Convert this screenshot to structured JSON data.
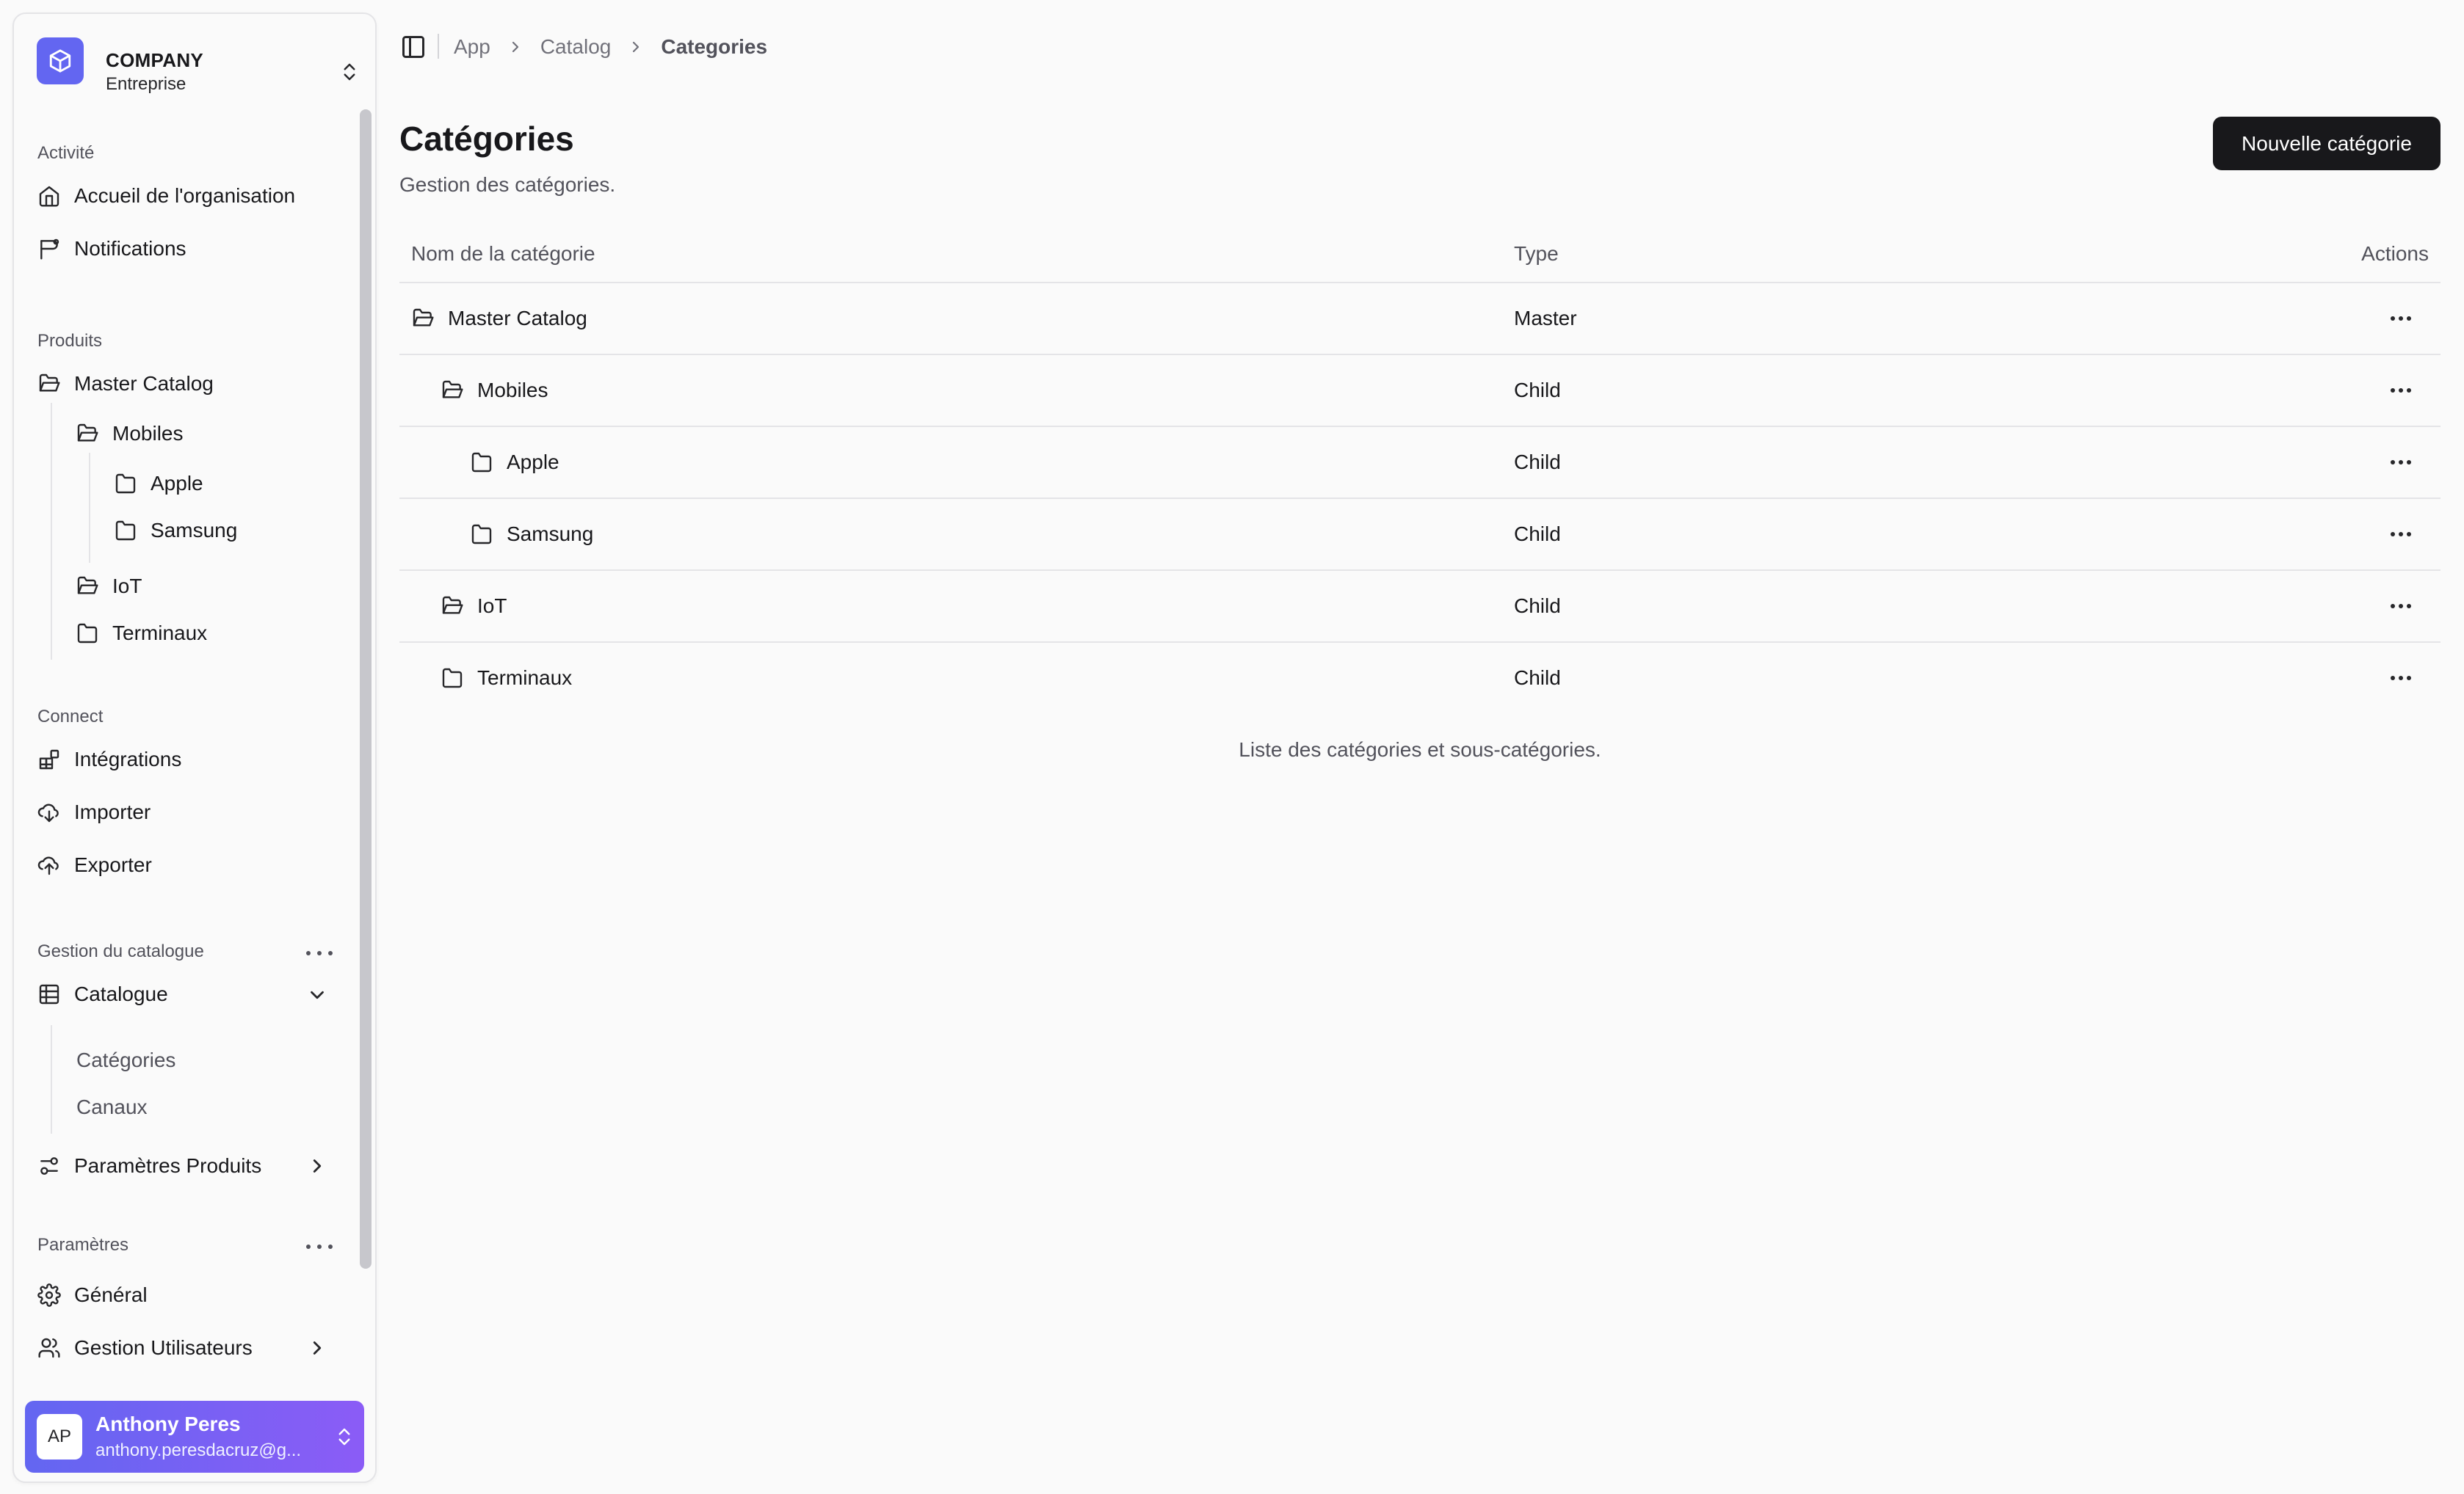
{
  "company": {
    "name": "COMPANY",
    "plan": "Entreprise"
  },
  "sidebar": {
    "groups": {
      "activite": "Activité",
      "produits": "Produits",
      "connect": "Connect",
      "gestion": "Gestion du catalogue",
      "parametres": "Paramètres"
    },
    "activite_items": [
      "Accueil de l'organisation",
      "Notifications"
    ],
    "produits_tree": {
      "master": "Master Catalog",
      "mobiles": "Mobiles",
      "apple": "Apple",
      "samsung": "Samsung",
      "iot": "IoT",
      "terminaux": "Terminaux"
    },
    "connect_items": [
      "Intégrations",
      "Importer",
      "Exporter"
    ],
    "catalogue": {
      "label": "Catalogue",
      "sub": [
        "Catégories",
        "Canaux"
      ]
    },
    "parametres_produits": "Paramètres Produits",
    "parametres_items": [
      "Général",
      "Gestion Utilisateurs"
    ]
  },
  "user": {
    "initials": "AP",
    "name": "Anthony Peres",
    "email": "anthony.peresdacruz@g..."
  },
  "breadcrumb": [
    "App",
    "Catalog",
    "Categories"
  ],
  "page": {
    "title": "Catégories",
    "subtitle": "Gestion des catégories.",
    "new_button": "Nouvelle catégorie"
  },
  "table": {
    "headers": {
      "name": "Nom de la catégorie",
      "type": "Type",
      "actions": "Actions"
    },
    "rows": [
      {
        "name": "Master Catalog",
        "type": "Master",
        "icon": "folder-open-icon"
      },
      {
        "name": "Mobiles",
        "type": "Child",
        "icon": "folder-open-icon"
      },
      {
        "name": "Apple",
        "type": "Child",
        "icon": "folder-icon"
      },
      {
        "name": "Samsung",
        "type": "Child",
        "icon": "folder-icon"
      },
      {
        "name": "IoT",
        "type": "Child",
        "icon": "folder-open-icon"
      },
      {
        "name": "Terminaux",
        "type": "Child",
        "icon": "folder-icon"
      }
    ],
    "caption": "Liste des catégories et sous-catégories."
  }
}
